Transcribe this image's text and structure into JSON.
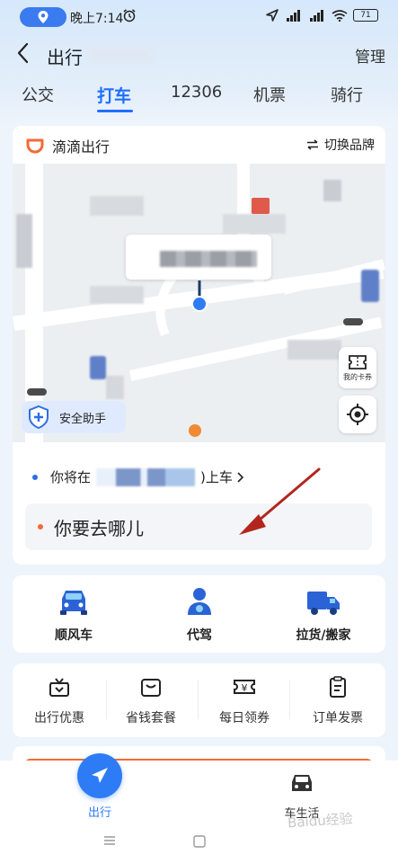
{
  "status_bar": {
    "time": "晚上7:14",
    "battery": "71"
  },
  "header": {
    "title": "出行",
    "manage_label": "管理"
  },
  "tabs": [
    {
      "label": "公交",
      "active": false
    },
    {
      "label": "打车",
      "active": true
    },
    {
      "label": "12306",
      "active": false
    },
    {
      "label": "机票",
      "active": false
    },
    {
      "label": "骑行",
      "active": false
    }
  ],
  "brand": {
    "name": "滴滴出行",
    "switch_label": "切换品牌"
  },
  "map": {
    "safety_label": "安全助手",
    "coupon_label": "我的卡券"
  },
  "pickup": {
    "prefix": "你将在",
    "suffix": ")上车"
  },
  "destination": {
    "placeholder": "你要去哪儿"
  },
  "services": [
    {
      "label": "顺风车",
      "icon": "car-front-icon"
    },
    {
      "label": "代驾",
      "icon": "driver-person-icon"
    },
    {
      "label": "拉货/搬家",
      "icon": "truck-icon"
    }
  ],
  "tools": [
    {
      "label": "出行优惠",
      "icon": "gift-box-icon"
    },
    {
      "label": "省钱套餐",
      "icon": "bag-icon"
    },
    {
      "label": "每日领券",
      "icon": "yen-coupon-icon"
    },
    {
      "label": "订单发票",
      "icon": "invoice-icon"
    }
  ],
  "bottom_nav": [
    {
      "label": "出行",
      "active": true
    },
    {
      "label": "车生活",
      "active": false
    }
  ],
  "colors": {
    "accent": "#1f6fff",
    "didi_orange": "#f46a35",
    "arrow_red": "#b3261e"
  }
}
